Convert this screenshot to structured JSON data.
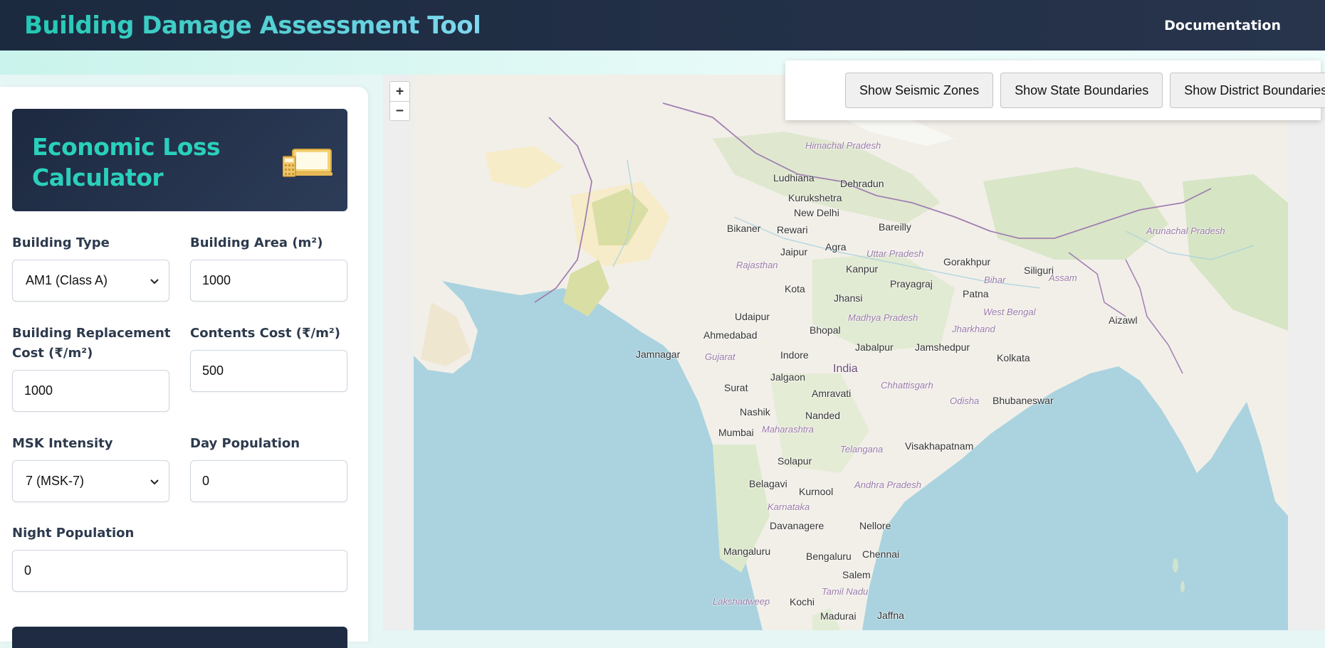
{
  "header": {
    "title": "Building Damage Assessment Tool",
    "documentation": "Documentation"
  },
  "calculator": {
    "title": "Economic Loss Calculator",
    "icon": "laptop-calculator-icon",
    "fields": {
      "building_type": {
        "label": "Building Type",
        "value": "AM1 (Class A)"
      },
      "building_area": {
        "label": "Building Area (m²)",
        "value": "1000"
      },
      "replacement_cost": {
        "label": "Building Replacement Cost (₹/m²)",
        "value": "1000"
      },
      "contents_cost": {
        "label": "Contents Cost (₹/m²)",
        "value": "500"
      },
      "msk_intensity": {
        "label": "MSK Intensity",
        "value": "7 (MSK-7)"
      },
      "day_population": {
        "label": "Day Population",
        "value": "0"
      },
      "night_population": {
        "label": "Night Population",
        "value": "0"
      }
    }
  },
  "map": {
    "zoom_in": "+",
    "zoom_out": "−",
    "labels": [
      "India",
      "New Delhi",
      "Ludhiana",
      "Dehradun",
      "Kurukshetra",
      "Bikaner",
      "Rewari",
      "Jaipur",
      "Agra",
      "Bareilly",
      "Kanpur",
      "Gorakhpur",
      "Prayagraj",
      "Patna",
      "Siliguri",
      "Kota",
      "Jhansi",
      "Udaipur",
      "Ahmedabad",
      "Bhopal",
      "Jabalpur",
      "Jamshedpur",
      "Kolkata",
      "Jamnagar",
      "Indore",
      "Jalgaon",
      "Amravati",
      "Surat",
      "Nashik",
      "Nanded",
      "Bhubaneswar",
      "Mumbai",
      "Visakhapatnam",
      "Solapur",
      "Belagavi",
      "Kurnool",
      "Nellore",
      "Davanagere",
      "Mangaluru",
      "Bengaluru",
      "Chennai",
      "Salem",
      "Kochi",
      "Madurai",
      "Jaffna",
      "Aizawl",
      "Rajasthan",
      "Uttar Pradesh",
      "Madhya Pradesh",
      "Gujarat",
      "Maharashtra",
      "Chhattisgarh",
      "Jharkhand",
      "Odisha",
      "Telangana",
      "Andhra Pradesh",
      "Karnataka",
      "Tamil Nadu",
      "West Bengal",
      "Assam",
      "Bihar",
      "Himachal Pradesh",
      "Arunachal Pradesh",
      "Lakshadweep"
    ]
  },
  "overlay_buttons": {
    "seismic": "Show Seismic Zones",
    "state": "Show State Boundaries",
    "district": "Show District Boundaries"
  },
  "colors": {
    "header_bg": "#1c2a40",
    "accent_teal": "#22c9b3",
    "sea": "#aad3df",
    "land": "#f2efe9"
  }
}
